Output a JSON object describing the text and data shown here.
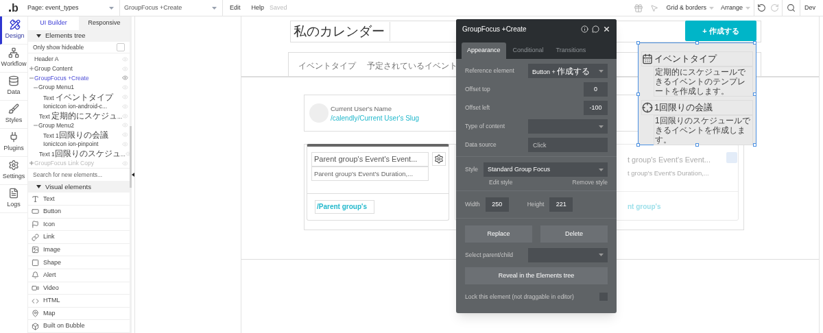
{
  "topbar": {
    "logo": "b",
    "page_selector": "Page: event_types",
    "element_selector": "GroupFocus +Create",
    "menu": [
      "Edit",
      "Help"
    ],
    "save_status": "Saved",
    "tools": [
      "Grid & borders",
      "Arrange"
    ],
    "cut_label": "Dev"
  },
  "rail": [
    {
      "label": "Design",
      "selected": true
    },
    {
      "label": "Workflow",
      "selected": false
    },
    {
      "label": "Data",
      "selected": false
    },
    {
      "label": "Styles",
      "selected": false
    },
    {
      "label": "Plugins",
      "selected": false
    },
    {
      "label": "Settings",
      "selected": false
    },
    {
      "label": "Logs",
      "selected": false
    }
  ],
  "panel": {
    "tabs": [
      {
        "label": "UI Builder",
        "selected": true
      },
      {
        "label": "Responsive",
        "selected": false
      }
    ],
    "tree_header": "Elements tree",
    "hideable": {
      "label": "Only show hideable",
      "checked": false
    },
    "tree": [
      {
        "label": "Header A",
        "selected": false,
        "hidden": false
      },
      {
        "label": "Group Content",
        "selected": false,
        "hidden": false,
        "expanded": false
      },
      {
        "label": "GroupFocus +Create",
        "selected": true,
        "hidden": false,
        "expanded": true,
        "children": [
          {
            "label": "Group Menu1",
            "selected": false,
            "hidden": false,
            "expanded": true,
            "children": [
              {
                "label": "Text イベントタイプ",
                "selected": false,
                "hidden": false
              },
              {
                "label": "IonicIcon ion-android-c...",
                "selected": false,
                "hidden": false
              },
              {
                "label": "Text 定期的にスケジュ...",
                "selected": false,
                "hidden": false
              }
            ]
          },
          {
            "label": "Group Menu2",
            "selected": false,
            "hidden": false,
            "expanded": true,
            "children": [
              {
                "label": "Text 1回限りの会議",
                "selected": false,
                "hidden": false
              },
              {
                "label": "IonicIcon ion-pinpoint",
                "selected": false,
                "hidden": false
              },
              {
                "label": "Text 1回限りのスケジュ...",
                "selected": false,
                "hidden": false
              }
            ]
          }
        ]
      },
      {
        "label": "GroupFocus Link Copy",
        "selected": false,
        "hidden": true,
        "expanded": false
      }
    ],
    "search": {
      "placeholder": "Search for new elements..."
    },
    "visual_header": "Visual elements",
    "visual_items": [
      "Text",
      "Button",
      "Icon",
      "Link",
      "Image",
      "Shape",
      "Alert",
      "Video",
      "HTML",
      "Map",
      "Built on Bubble"
    ]
  },
  "page": {
    "title": "私のカレンダー",
    "create_button": "+ 作成する",
    "nav": [
      "イベントタイプ",
      "予定されているイベント"
    ],
    "user": {
      "name": "Current User's Name",
      "slug": "/calendly/Current User's Slug"
    },
    "card": {
      "title": "Parent group's Event's Event...",
      "duration": "Parent group's Event's Duration,...",
      "slug": "/Parent group's"
    },
    "card_fragment": {
      "title": "t group's Event's Event...",
      "duration": "t group's Event's Duration,...",
      "slug": "nt group's"
    },
    "focus_menu": [
      {
        "title": "イベントタイプ",
        "description": "定期的にスケジュールできるイベントのテンプレートを作成します。"
      },
      {
        "title": "1回限りの会議",
        "description": "1回限りのスケジュールできるイベントを作成します。"
      }
    ]
  },
  "inspector": {
    "title": "GroupFocus +Create",
    "tabs": [
      {
        "label": "Appearance",
        "selected": true
      },
      {
        "label": "Conditional",
        "selected": false
      },
      {
        "label": "Transitions",
        "selected": false
      }
    ],
    "fields": [
      {
        "label": "Reference element",
        "kind": "dropdown",
        "value": "Button + 作成する"
      },
      {
        "label": "Offset top",
        "kind": "number",
        "value": "0"
      },
      {
        "label": "Offset left",
        "kind": "number",
        "value": "-100"
      },
      {
        "label": "Type of content",
        "kind": "dropdown"
      },
      {
        "label": "Data source",
        "kind": "source",
        "placeholder": "Click"
      }
    ],
    "style": {
      "label": "Style",
      "value": "Standard Group Focus",
      "edit": "Edit style",
      "remove": "Remove style"
    },
    "width": {
      "label": "Width",
      "value": "250"
    },
    "height": {
      "label": "Height",
      "value": "221"
    },
    "buttons": [
      "Replace",
      "Delete"
    ],
    "select_parent": {
      "label": "Select parent/child"
    },
    "reveal": "Reveal in the Elements tree",
    "lock": {
      "label": "Lock this element (not draggable in editor)",
      "checked": false
    }
  }
}
